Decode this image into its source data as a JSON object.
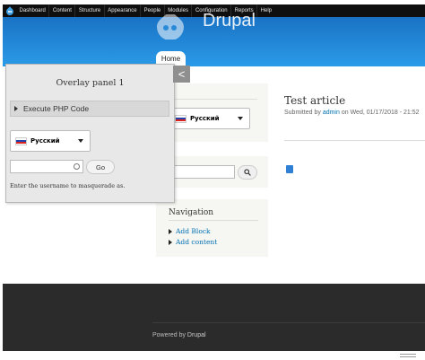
{
  "toolbar": {
    "items": [
      "Dashboard",
      "Content",
      "Structure",
      "Appearance",
      "People",
      "Modules",
      "Configuration",
      "Reports",
      "Help"
    ]
  },
  "header": {
    "site_name": "Drupal",
    "tab_home": "Home"
  },
  "language_switcher": {
    "selected": "Русский"
  },
  "navigation": {
    "title": "Navigation",
    "items": [
      "Add Block",
      "Add content"
    ]
  },
  "article": {
    "title": "Test article",
    "submitted_prefix": "Submitted by",
    "author": "admin",
    "submitted_suffix": "on Wed, 01/17/2018 - 21:52"
  },
  "footer": {
    "powered_prefix": "Powered by",
    "powered_link": "Drupal"
  },
  "overlay": {
    "title": "Overlay panel 1",
    "php_label": "Execute PHP Code",
    "language_selected": "Русский",
    "go_label": "Go",
    "help_text": "Enter the username to masquerade as.",
    "collapse_glyph": "<"
  },
  "colors": {
    "toolbar_bg": "#0f0f0f",
    "header_blue": "#1a72c4",
    "link": "#0071b3",
    "footer_bg": "#2b2b2b"
  }
}
